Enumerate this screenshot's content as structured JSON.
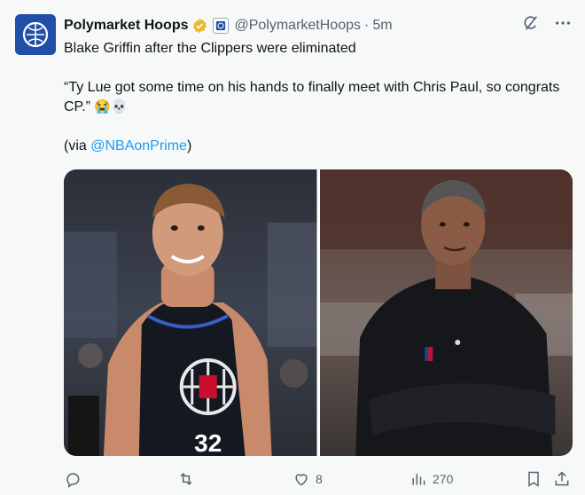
{
  "account": {
    "name": "Polymarket Hoops",
    "handle": "@PolymarketHoops",
    "separator": "·",
    "time": "5m"
  },
  "tweet": {
    "line1": "Blake Griffin after the Clippers were eliminated",
    "quote": "“Ty Lue got some time on his hands to finally meet with Chris Paul, so congrats CP.”",
    "emojis": "😭💀",
    "via_prefix": "(via ",
    "via_link": "@NBAonPrime",
    "via_suffix": ")"
  },
  "media": {
    "left_jersey_number": "32"
  },
  "actions": {
    "reply_count": "",
    "retweet_count": "",
    "like_count": "8",
    "views_count": "270"
  },
  "icons": {
    "verified": "verified-badge-icon",
    "affiliate": "affiliate-badge-icon",
    "grok": "grok-icon",
    "more": "more-icon",
    "reply": "reply-icon",
    "retweet": "retweet-icon",
    "like": "like-icon",
    "views": "views-icon",
    "bookmark": "bookmark-icon",
    "share": "share-icon"
  },
  "colors": {
    "background": "#f7f9f9",
    "link": "#1d9bf0",
    "verified": "#e8b82e",
    "secondary_text": "#536471"
  }
}
